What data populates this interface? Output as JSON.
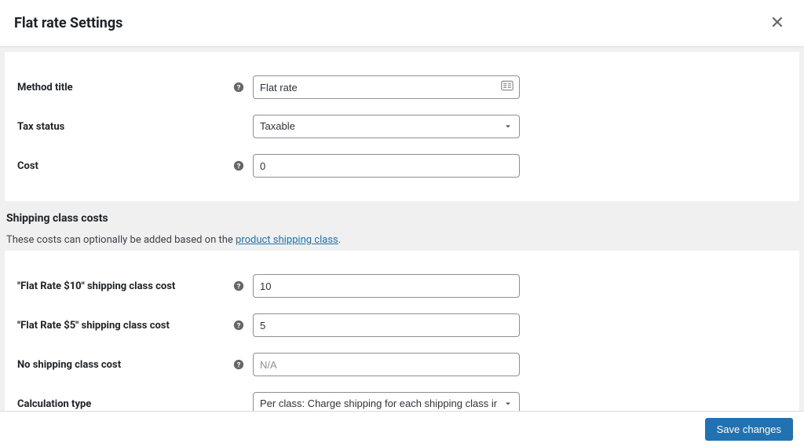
{
  "header": {
    "title": "Flat rate Settings"
  },
  "fields": {
    "method_title": {
      "label": "Method title",
      "value": "Flat rate"
    },
    "tax_status": {
      "label": "Tax status",
      "value": "Taxable"
    },
    "cost": {
      "label": "Cost",
      "value": "0"
    }
  },
  "shipping_section": {
    "heading": "Shipping class costs",
    "desc_prefix": "These costs can optionally be added based on the ",
    "desc_link": "product shipping class",
    "desc_suffix": "."
  },
  "class_fields": {
    "class10": {
      "label": "\"Flat Rate $10\" shipping class cost",
      "value": "10"
    },
    "class5": {
      "label": "\"Flat Rate $5\" shipping class cost",
      "value": "5"
    },
    "no_class": {
      "label": "No shipping class cost",
      "placeholder": "N/A"
    },
    "calc_type": {
      "label": "Calculation type",
      "value": "Per class: Charge shipping for each shipping class individually"
    }
  },
  "footer": {
    "save": "Save changes"
  }
}
